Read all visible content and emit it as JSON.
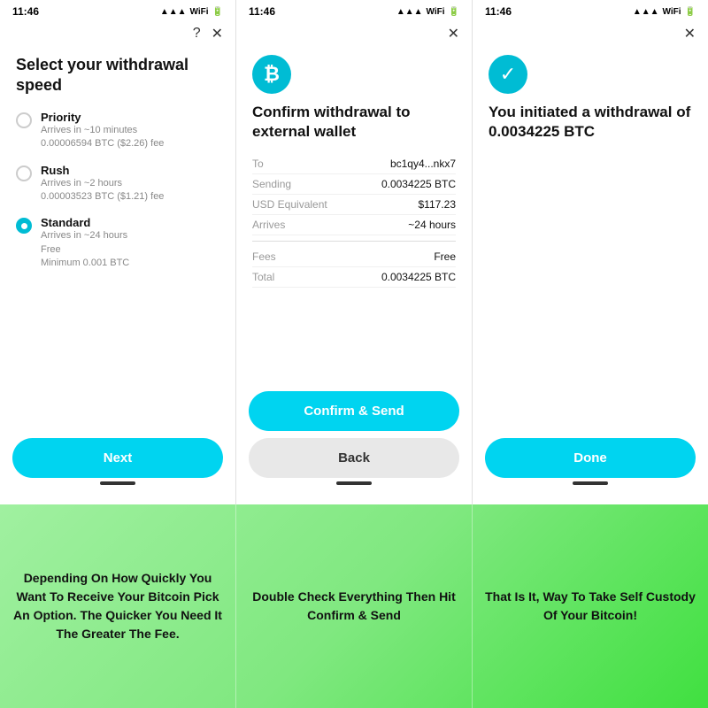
{
  "screens": [
    {
      "id": "screen1",
      "statusTime": "11:46",
      "headerIcons": [
        "?",
        "✕"
      ],
      "title": "Select your withdrawal speed",
      "options": [
        {
          "id": "priority",
          "selected": false,
          "name": "Priority",
          "sub1": "Arrives in ~10 minutes",
          "sub2": "0.00006594 BTC ($2.26) fee"
        },
        {
          "id": "rush",
          "selected": false,
          "name": "Rush",
          "sub1": "Arrives in ~2 hours",
          "sub2": "0.00003523 BTC ($1.21) fee"
        },
        {
          "id": "standard",
          "selected": true,
          "name": "Standard",
          "sub1": "Arrives in ~24 hours",
          "sub2": "Free",
          "sub3": "Minimum 0.001 BTC"
        }
      ],
      "nextBtn": "Next"
    },
    {
      "id": "screen2",
      "statusTime": "11:46",
      "headerIcons": [
        "✕"
      ],
      "iconType": "btc",
      "title": "Confirm withdrawal to external wallet",
      "details": [
        {
          "label": "To",
          "value": "bc1qy4...nkx7"
        },
        {
          "label": "Sending",
          "value": "0.0034225 BTC"
        },
        {
          "label": "USD Equivalent",
          "value": "$117.23"
        },
        {
          "label": "Arrives",
          "value": "~24 hours"
        }
      ],
      "feesDetails": [
        {
          "label": "Fees",
          "value": "Free"
        },
        {
          "label": "Total",
          "value": "0.0034225 BTC"
        }
      ],
      "confirmBtn": "Confirm & Send",
      "backBtn": "Back"
    },
    {
      "id": "screen3",
      "statusTime": "11:46",
      "headerIcons": [
        "✕"
      ],
      "iconType": "check",
      "title": "You initiated a withdrawal of 0.0034225 BTC",
      "doneBtn": "Done"
    }
  ],
  "captions": [
    {
      "id": "caption1",
      "text": "Depending On How Quickly You Want To Receive Your Bitcoin Pick An Option. The Quicker You Need It The Greater The Fee."
    },
    {
      "id": "caption2",
      "text": "Double Check Everything Then Hit Confirm & Send"
    },
    {
      "id": "caption3",
      "text": "That Is It, Way To Take Self Custody Of Your Bitcoin!"
    }
  ]
}
